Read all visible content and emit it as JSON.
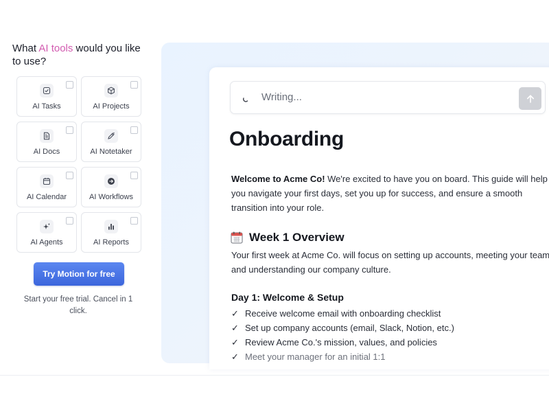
{
  "question": {
    "before": "What ",
    "highlight": "AI tools",
    "after": " would you like to use?"
  },
  "tools": [
    {
      "label": "AI Tasks",
      "icon": "task-check-icon"
    },
    {
      "label": "AI Projects",
      "icon": "cube-icon"
    },
    {
      "label": "AI Docs",
      "icon": "document-icon"
    },
    {
      "label": "AI Notetaker",
      "icon": "pen-icon"
    },
    {
      "label": "AI Calendar",
      "icon": "calendar-icon"
    },
    {
      "label": "AI Workflows",
      "icon": "arrow-circle-icon"
    },
    {
      "label": "AI Agents",
      "icon": "sparkle-icon"
    },
    {
      "label": "AI Reports",
      "icon": "bar-chart-icon"
    }
  ],
  "cta": {
    "label": "Try Motion for free"
  },
  "trial_text": "Start your free trial. Cancel in 1 click.",
  "prompt": {
    "text": "Writing..."
  },
  "doc": {
    "title": "Onboarding",
    "welcome_bold": "Welcome to Acme Co!",
    "welcome_rest": " We're excited to have you on board. This guide will help you navigate your first days, set you up for success, and ensure a smooth transition into your role.",
    "week_title": "Week 1 Overview",
    "week_text": "Your first week at Acme Co. will focus on setting up accounts, meeting your team, and understanding our company culture.",
    "day_title": "Day 1: Welcome & Setup",
    "check_mark": "✓",
    "checklist": [
      "Receive welcome email with onboarding checklist",
      "Set up company accounts (email, Slack, Notion, etc.)",
      "Review Acme Co.'s mission, values, and policies",
      "Meet your manager for an initial 1:1"
    ]
  },
  "colors": {
    "highlight": "#d25bb0",
    "cta": "#4a74e6",
    "panel": "#e9f3ff"
  }
}
